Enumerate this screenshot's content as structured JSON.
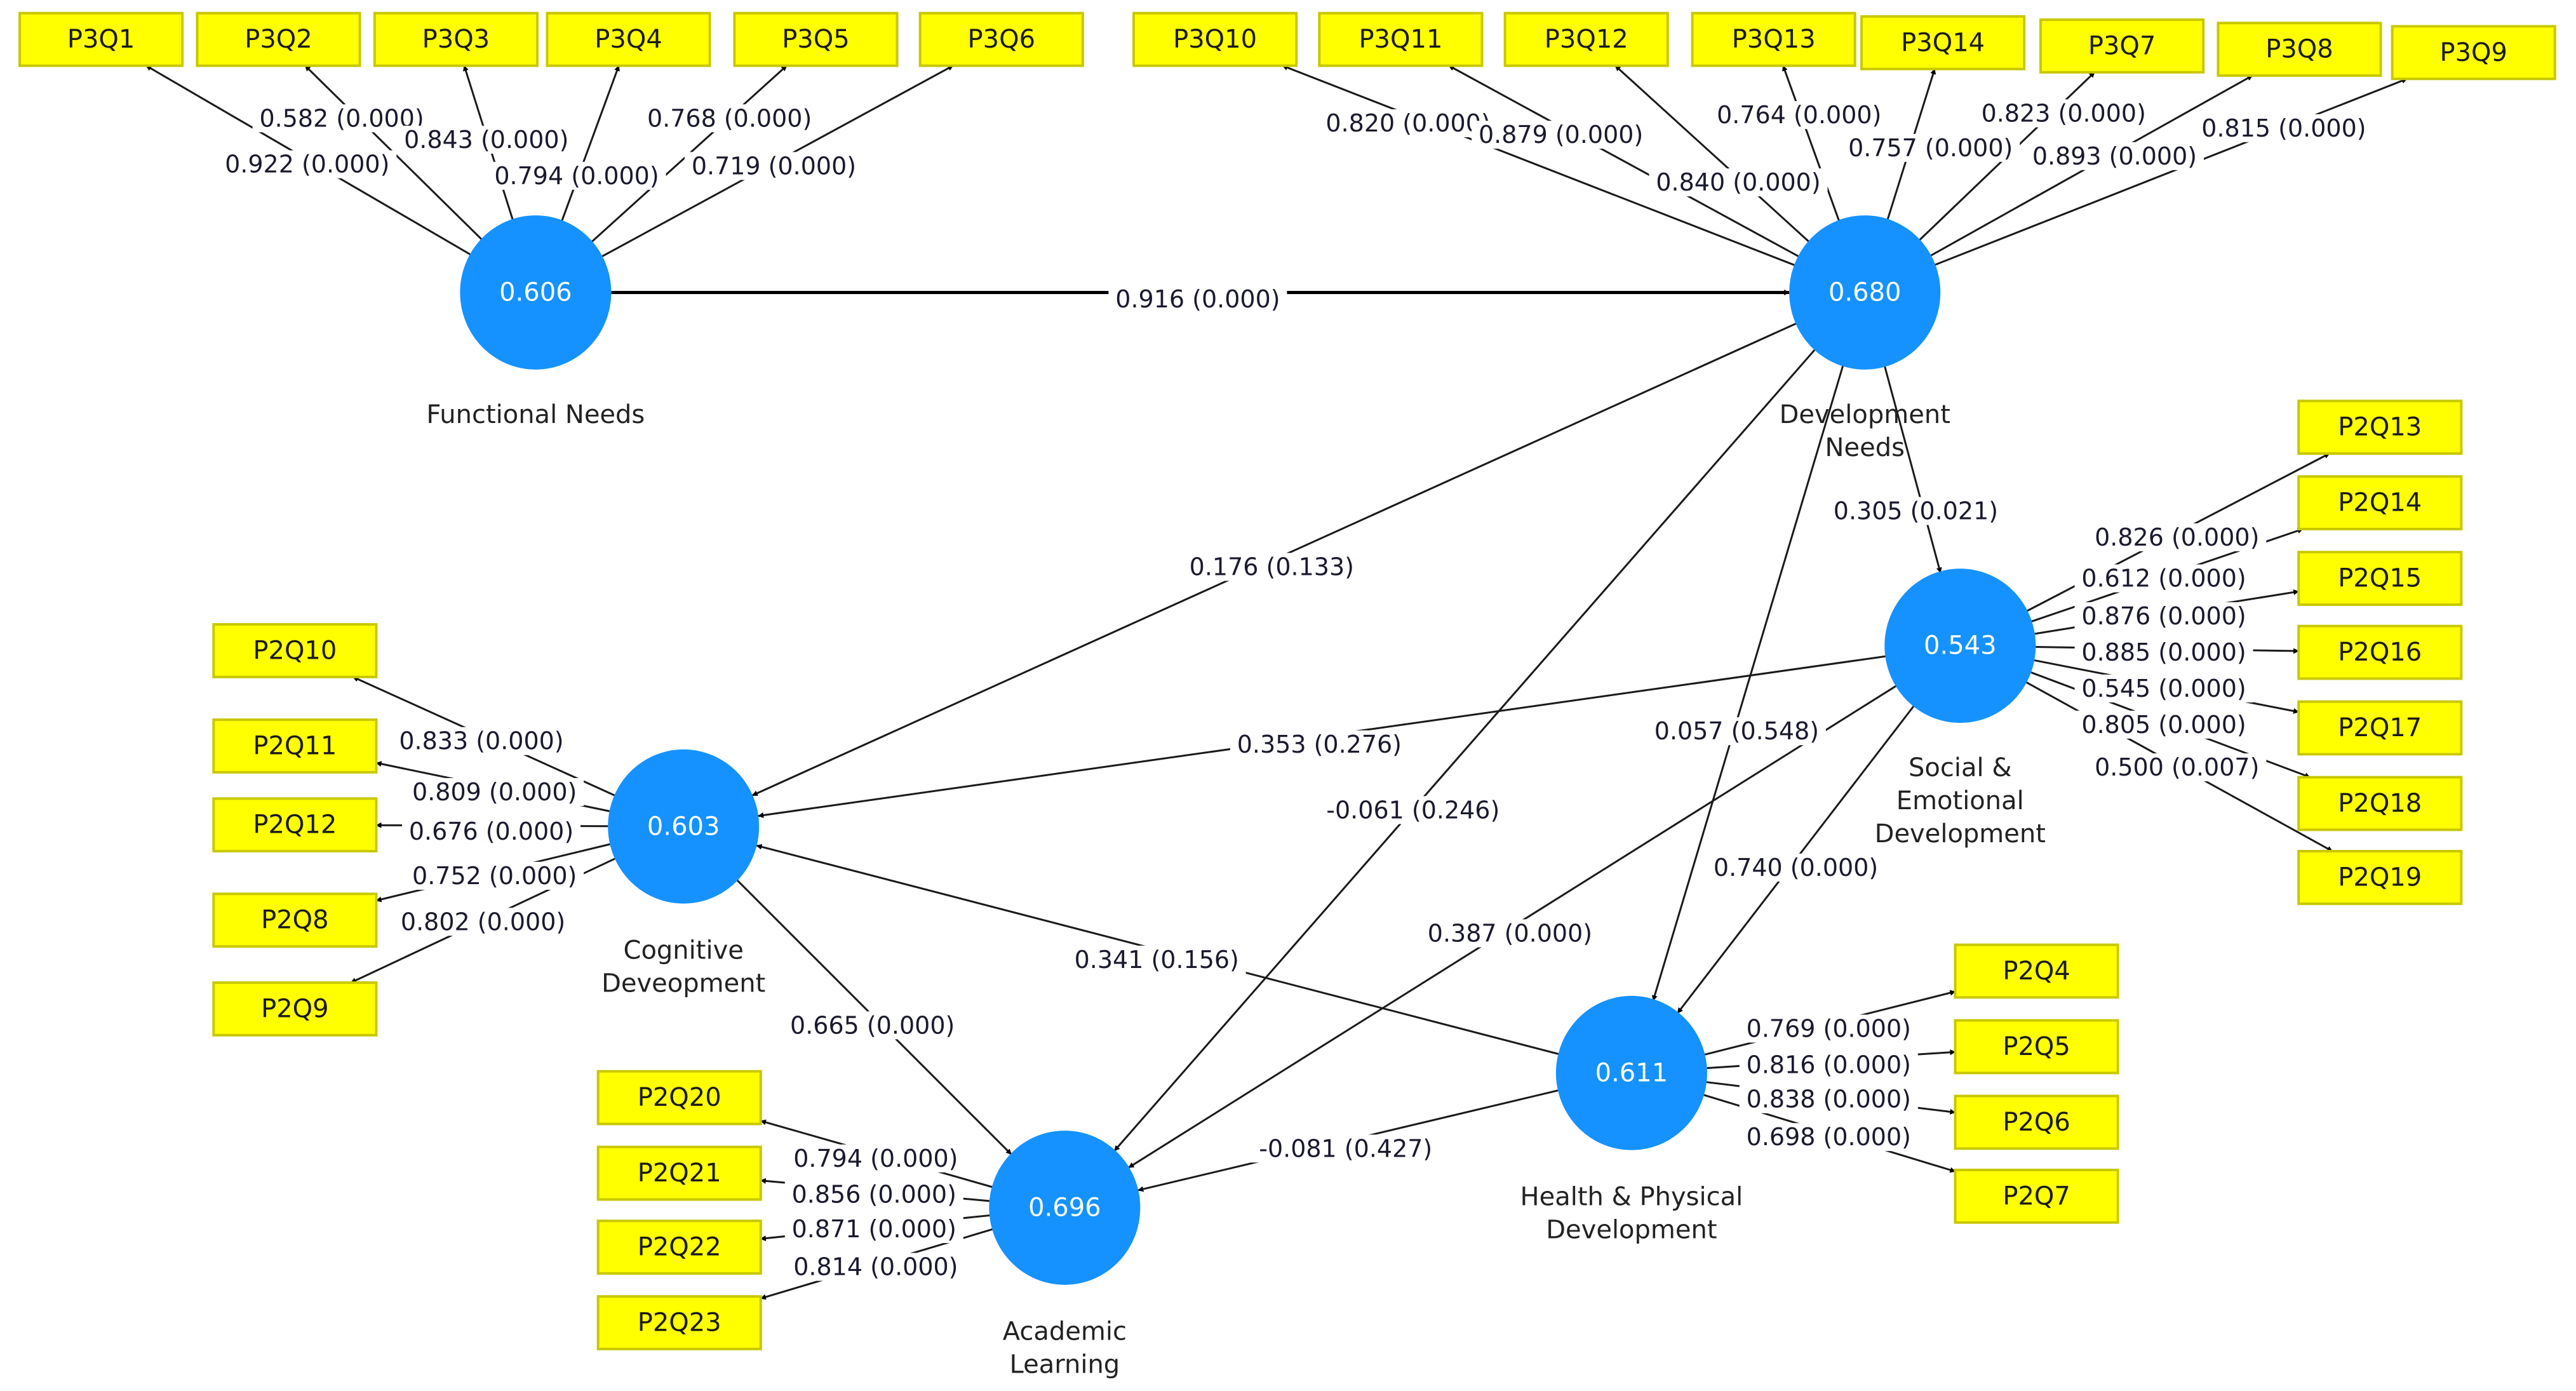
{
  "diagram": {
    "type": "PLS-SEM path model",
    "colors": {
      "latent": "#1592ff",
      "indicator": "#ffff00",
      "indicator_border": "#c8c800",
      "edge": "#1a1a1a"
    },
    "latent_variables": [
      {
        "id": "FN",
        "name": "Functional Needs",
        "name_lines": [
          "Functional Needs"
        ],
        "r2": "0.606"
      },
      {
        "id": "DN",
        "name": "Development Needs",
        "name_lines": [
          "Development",
          "Needs"
        ],
        "r2": "0.680"
      },
      {
        "id": "SE",
        "name": "Social & Emotional Development",
        "name_lines": [
          "Social &",
          "Emotional",
          "Development"
        ],
        "r2": "0.543"
      },
      {
        "id": "CD",
        "name": "Cognitive Deveopment",
        "name_lines": [
          "Cognitive",
          "Deveopment"
        ],
        "r2": "0.603"
      },
      {
        "id": "AL",
        "name": "Academic Learning",
        "name_lines": [
          "Academic",
          "Learning"
        ],
        "r2": "0.696"
      },
      {
        "id": "HP",
        "name": "Health & Physical Development",
        "name_lines": [
          "Health & Physical",
          "Development"
        ],
        "r2": "0.611"
      }
    ],
    "indicators": [
      {
        "id": "P3Q1",
        "label": "P3Q1",
        "lv": "FN",
        "loading": "0.922 (0.000)"
      },
      {
        "id": "P3Q2",
        "label": "P3Q2",
        "lv": "FN",
        "loading": "0.582 (0.000)"
      },
      {
        "id": "P3Q3",
        "label": "P3Q3",
        "lv": "FN",
        "loading": "0.843 (0.000)"
      },
      {
        "id": "P3Q4",
        "label": "P3Q4",
        "lv": "FN",
        "loading": "0.794 (0.000)"
      },
      {
        "id": "P3Q5",
        "label": "P3Q5",
        "lv": "FN",
        "loading": "0.768 (0.000)"
      },
      {
        "id": "P3Q6",
        "label": "P3Q6",
        "lv": "FN",
        "loading": "0.719 (0.000)"
      },
      {
        "id": "P3Q10",
        "label": "P3Q10",
        "lv": "DN",
        "loading": "0.820 (0.000)"
      },
      {
        "id": "P3Q11",
        "label": "P3Q11",
        "lv": "DN",
        "loading": "0.879 (0.000)"
      },
      {
        "id": "P3Q12",
        "label": "P3Q12",
        "lv": "DN",
        "loading": "0.840 (0.000)"
      },
      {
        "id": "P3Q13",
        "label": "P3Q13",
        "lv": "DN",
        "loading": "0.764 (0.000)"
      },
      {
        "id": "P3Q14",
        "label": "P3Q14",
        "lv": "DN",
        "loading": "0.757 (0.000)"
      },
      {
        "id": "P3Q7",
        "label": "P3Q7",
        "lv": "DN",
        "loading": "0.823 (0.000)"
      },
      {
        "id": "P3Q8",
        "label": "P3Q8",
        "lv": "DN",
        "loading": "0.893 (0.000)"
      },
      {
        "id": "P3Q9",
        "label": "P3Q9",
        "lv": "DN",
        "loading": "0.815 (0.000)"
      },
      {
        "id": "P2Q13",
        "label": "P2Q13",
        "lv": "SE",
        "loading": "0.826 (0.000)"
      },
      {
        "id": "P2Q14",
        "label": "P2Q14",
        "lv": "SE",
        "loading": "0.612 (0.000)"
      },
      {
        "id": "P2Q15",
        "label": "P2Q15",
        "lv": "SE",
        "loading": "0.876 (0.000)"
      },
      {
        "id": "P2Q16",
        "label": "P2Q16",
        "lv": "SE",
        "loading": "0.885 (0.000)"
      },
      {
        "id": "P2Q17",
        "label": "P2Q17",
        "lv": "SE",
        "loading": "0.545 (0.000)"
      },
      {
        "id": "P2Q18",
        "label": "P2Q18",
        "lv": "SE",
        "loading": "0.805 (0.000)"
      },
      {
        "id": "P2Q19",
        "label": "P2Q19",
        "lv": "SE",
        "loading": "0.500 (0.007)"
      },
      {
        "id": "P2Q10",
        "label": "P2Q10",
        "lv": "CD",
        "loading": "0.833 (0.000)"
      },
      {
        "id": "P2Q11",
        "label": "P2Q11",
        "lv": "CD",
        "loading": "0.809 (0.000)"
      },
      {
        "id": "P2Q12",
        "label": "P2Q12",
        "lv": "CD",
        "loading": "0.676 (0.000)"
      },
      {
        "id": "P2Q8",
        "label": "P2Q8",
        "lv": "CD",
        "loading": "0.752 (0.000)"
      },
      {
        "id": "P2Q9",
        "label": "P2Q9",
        "lv": "CD",
        "loading": "0.802 (0.000)"
      },
      {
        "id": "P2Q20",
        "label": "P2Q20",
        "lv": "AL",
        "loading": "0.794 (0.000)"
      },
      {
        "id": "P2Q21",
        "label": "P2Q21",
        "lv": "AL",
        "loading": "0.856 (0.000)"
      },
      {
        "id": "P2Q22",
        "label": "P2Q22",
        "lv": "AL",
        "loading": "0.871 (0.000)"
      },
      {
        "id": "P2Q23",
        "label": "P2Q23",
        "lv": "AL",
        "loading": "0.814 (0.000)"
      },
      {
        "id": "P2Q4",
        "label": "P2Q4",
        "lv": "HP",
        "loading": "0.769 (0.000)"
      },
      {
        "id": "P2Q5",
        "label": "P2Q5",
        "lv": "HP",
        "loading": "0.816 (0.000)"
      },
      {
        "id": "P2Q6",
        "label": "P2Q6",
        "lv": "HP",
        "loading": "0.838 (0.000)"
      },
      {
        "id": "P2Q7",
        "label": "P2Q7",
        "lv": "HP",
        "loading": "0.698 (0.000)"
      }
    ],
    "paths": [
      {
        "from": "FN",
        "to": "DN",
        "label": "0.916 (0.000)"
      },
      {
        "from": "DN",
        "to": "CD",
        "label": "0.176 (0.133)"
      },
      {
        "from": "DN",
        "to": "SE",
        "label": "0.305 (0.021)"
      },
      {
        "from": "DN",
        "to": "AL",
        "label": "-0.061 (0.246)"
      },
      {
        "from": "DN",
        "to": "HP",
        "label": "0.057 (0.548)"
      },
      {
        "from": "SE",
        "to": "CD",
        "label": "0.353 (0.276)"
      },
      {
        "from": "SE",
        "to": "AL",
        "label": "0.387 (0.000)"
      },
      {
        "from": "SE",
        "to": "HP",
        "label": "0.740 (0.000)"
      },
      {
        "from": "HP",
        "to": "CD",
        "label": "0.341 (0.156)"
      },
      {
        "from": "HP",
        "to": "AL",
        "label": "-0.081 (0.427)"
      },
      {
        "from": "CD",
        "to": "AL",
        "label": "0.665 (0.000)"
      }
    ]
  }
}
